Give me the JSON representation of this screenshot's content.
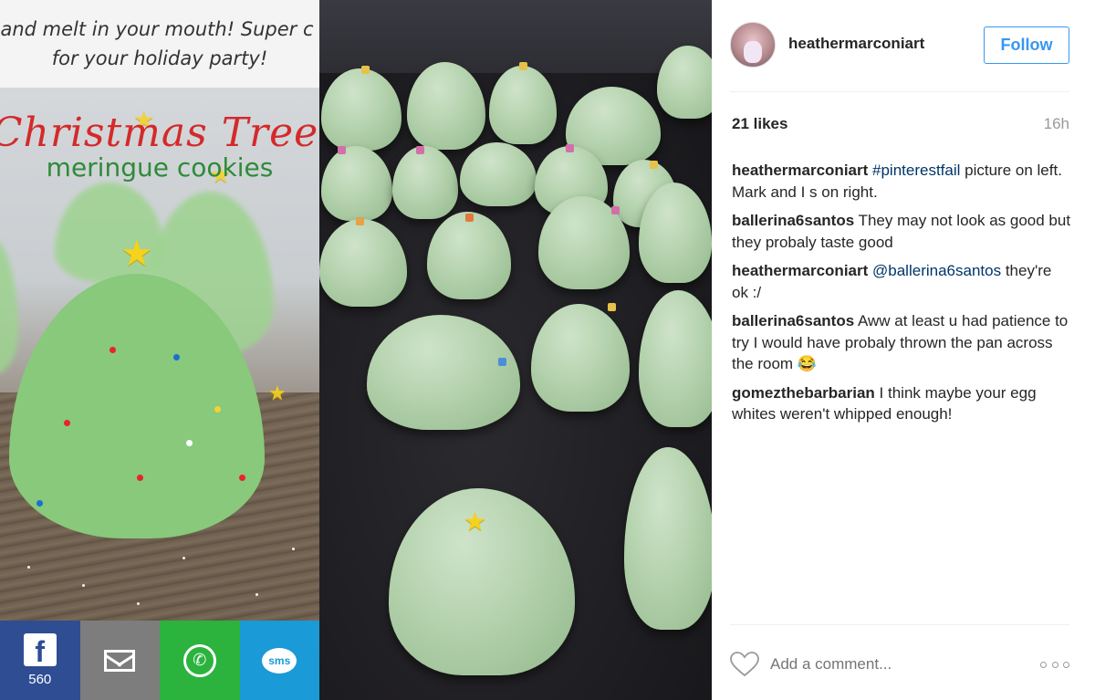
{
  "post_image": {
    "pin_caption_line1": "air and melt in your mouth! Super c",
    "pin_caption_line2": "for your holiday party!",
    "pin_title_line1": "Christmas Tree",
    "pin_title_line2": "meringue cookies",
    "share": {
      "facebook_icon": "facebook-icon",
      "facebook_count": "560",
      "email_icon": "envelope-icon",
      "whatsapp_icon": "whatsapp-icon",
      "sms_icon": "sms-icon",
      "sms_label": "sms"
    }
  },
  "header": {
    "username": "heathermarconiart",
    "follow_label": "Follow"
  },
  "stats": {
    "likes": "21 likes",
    "time": "16h"
  },
  "comments": [
    {
      "user": "heathermarconiart",
      "parts": [
        {
          "tag": "#pinterestfail"
        },
        {
          "text": " picture on left. Mark and I s on right."
        }
      ]
    },
    {
      "user": "ballerina6santos",
      "parts": [
        {
          "text": "They may not look as good but they probaly taste good"
        }
      ]
    },
    {
      "user": "heathermarconiart",
      "parts": [
        {
          "tag": "@ballerina6santos"
        },
        {
          "text": " they're ok :/"
        }
      ]
    },
    {
      "user": "ballerina6santos",
      "parts": [
        {
          "text": "Aww at least u had patience to try I would have probaly thrown the pan across the room 😂"
        }
      ]
    },
    {
      "user": "gomezthebarbarian",
      "parts": [
        {
          "text": "I think maybe your egg whites weren't whipped enough!"
        }
      ]
    }
  ],
  "add_comment": {
    "placeholder": "Add a comment...",
    "like_icon": "heart-icon",
    "more_icon": "more-options-icon"
  },
  "colors": {
    "accent": "#3897f0",
    "hashtag": "#003569",
    "muted": "#999999"
  }
}
